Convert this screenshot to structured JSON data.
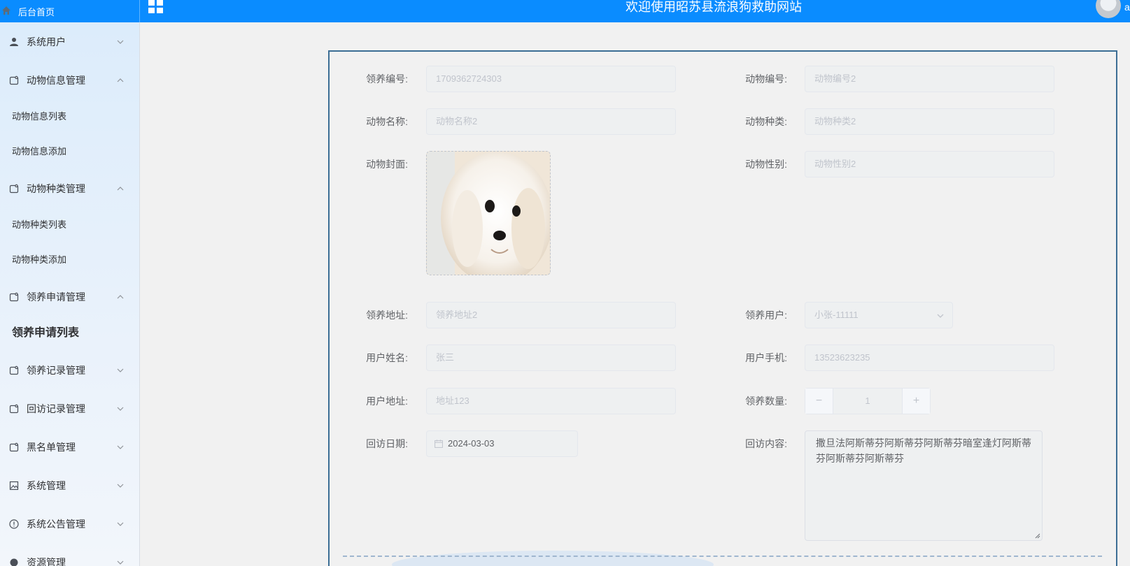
{
  "header": {
    "home_label": "后台首页",
    "site_title": "欢迎使用昭苏县流浪狗救助网站",
    "user_initial": "a"
  },
  "sidebar": {
    "items": [
      {
        "label": "系统用户",
        "icon": "user-icon",
        "expanded": false
      },
      {
        "label": "动物信息管理",
        "icon": "tag-icon",
        "expanded": true
      },
      {
        "label": "动物信息列表",
        "sub": true
      },
      {
        "label": "动物信息添加",
        "sub": true
      },
      {
        "label": "动物种类管理",
        "icon": "tag-icon",
        "expanded": true
      },
      {
        "label": "动物种类列表",
        "sub": true
      },
      {
        "label": "动物种类添加",
        "sub": true
      },
      {
        "label": "领养申请管理",
        "icon": "tag-icon",
        "expanded": true
      },
      {
        "label": "领养申请列表",
        "sub": true,
        "active": true
      },
      {
        "label": "领养记录管理",
        "icon": "tag-icon",
        "expanded": false
      },
      {
        "label": "回访记录管理",
        "icon": "tag-icon",
        "expanded": false
      },
      {
        "label": "黑名单管理",
        "icon": "tag-icon",
        "expanded": false
      },
      {
        "label": "系统管理",
        "icon": "picture-icon",
        "expanded": false
      },
      {
        "label": "系统公告管理",
        "icon": "info-icon",
        "expanded": false
      },
      {
        "label": "资源管理",
        "icon": "circle-icon",
        "expanded": false
      }
    ]
  },
  "form": {
    "adopt_no": {
      "label": "领养编号:",
      "value": "1709362724303"
    },
    "animal_no": {
      "label": "动物编号:",
      "value": "动物编号2"
    },
    "animal_name": {
      "label": "动物名称:",
      "value": "动物名称2"
    },
    "animal_kind": {
      "label": "动物种类:",
      "value": "动物种类2"
    },
    "animal_cover": {
      "label": "动物封面:"
    },
    "animal_gender": {
      "label": "动物性别:",
      "value": "动物性别2"
    },
    "adopt_address": {
      "label": "领养地址:",
      "value": "领养地址2"
    },
    "adopt_user": {
      "label": "领养用户:",
      "value": "小张-11111"
    },
    "user_name": {
      "label": "用户姓名:",
      "value": "张三"
    },
    "user_phone": {
      "label": "用户手机:",
      "value": "13523623235"
    },
    "user_address": {
      "label": "用户地址:",
      "value": "地址123"
    },
    "adopt_count": {
      "label": "领养数量:",
      "value": "1",
      "minus": "−",
      "plus": "+"
    },
    "visit_date": {
      "label": "回访日期:",
      "value": "2024-03-03"
    },
    "visit_content": {
      "label": "回访内容:",
      "value": "撒旦法阿斯蒂芬阿斯蒂芬阿斯蒂芬暗室逢灯阿斯蒂芬阿斯蒂芬阿斯蒂芬"
    }
  },
  "colors": {
    "topbar": "#0a8cff",
    "panel_border": "#3c6e95"
  }
}
